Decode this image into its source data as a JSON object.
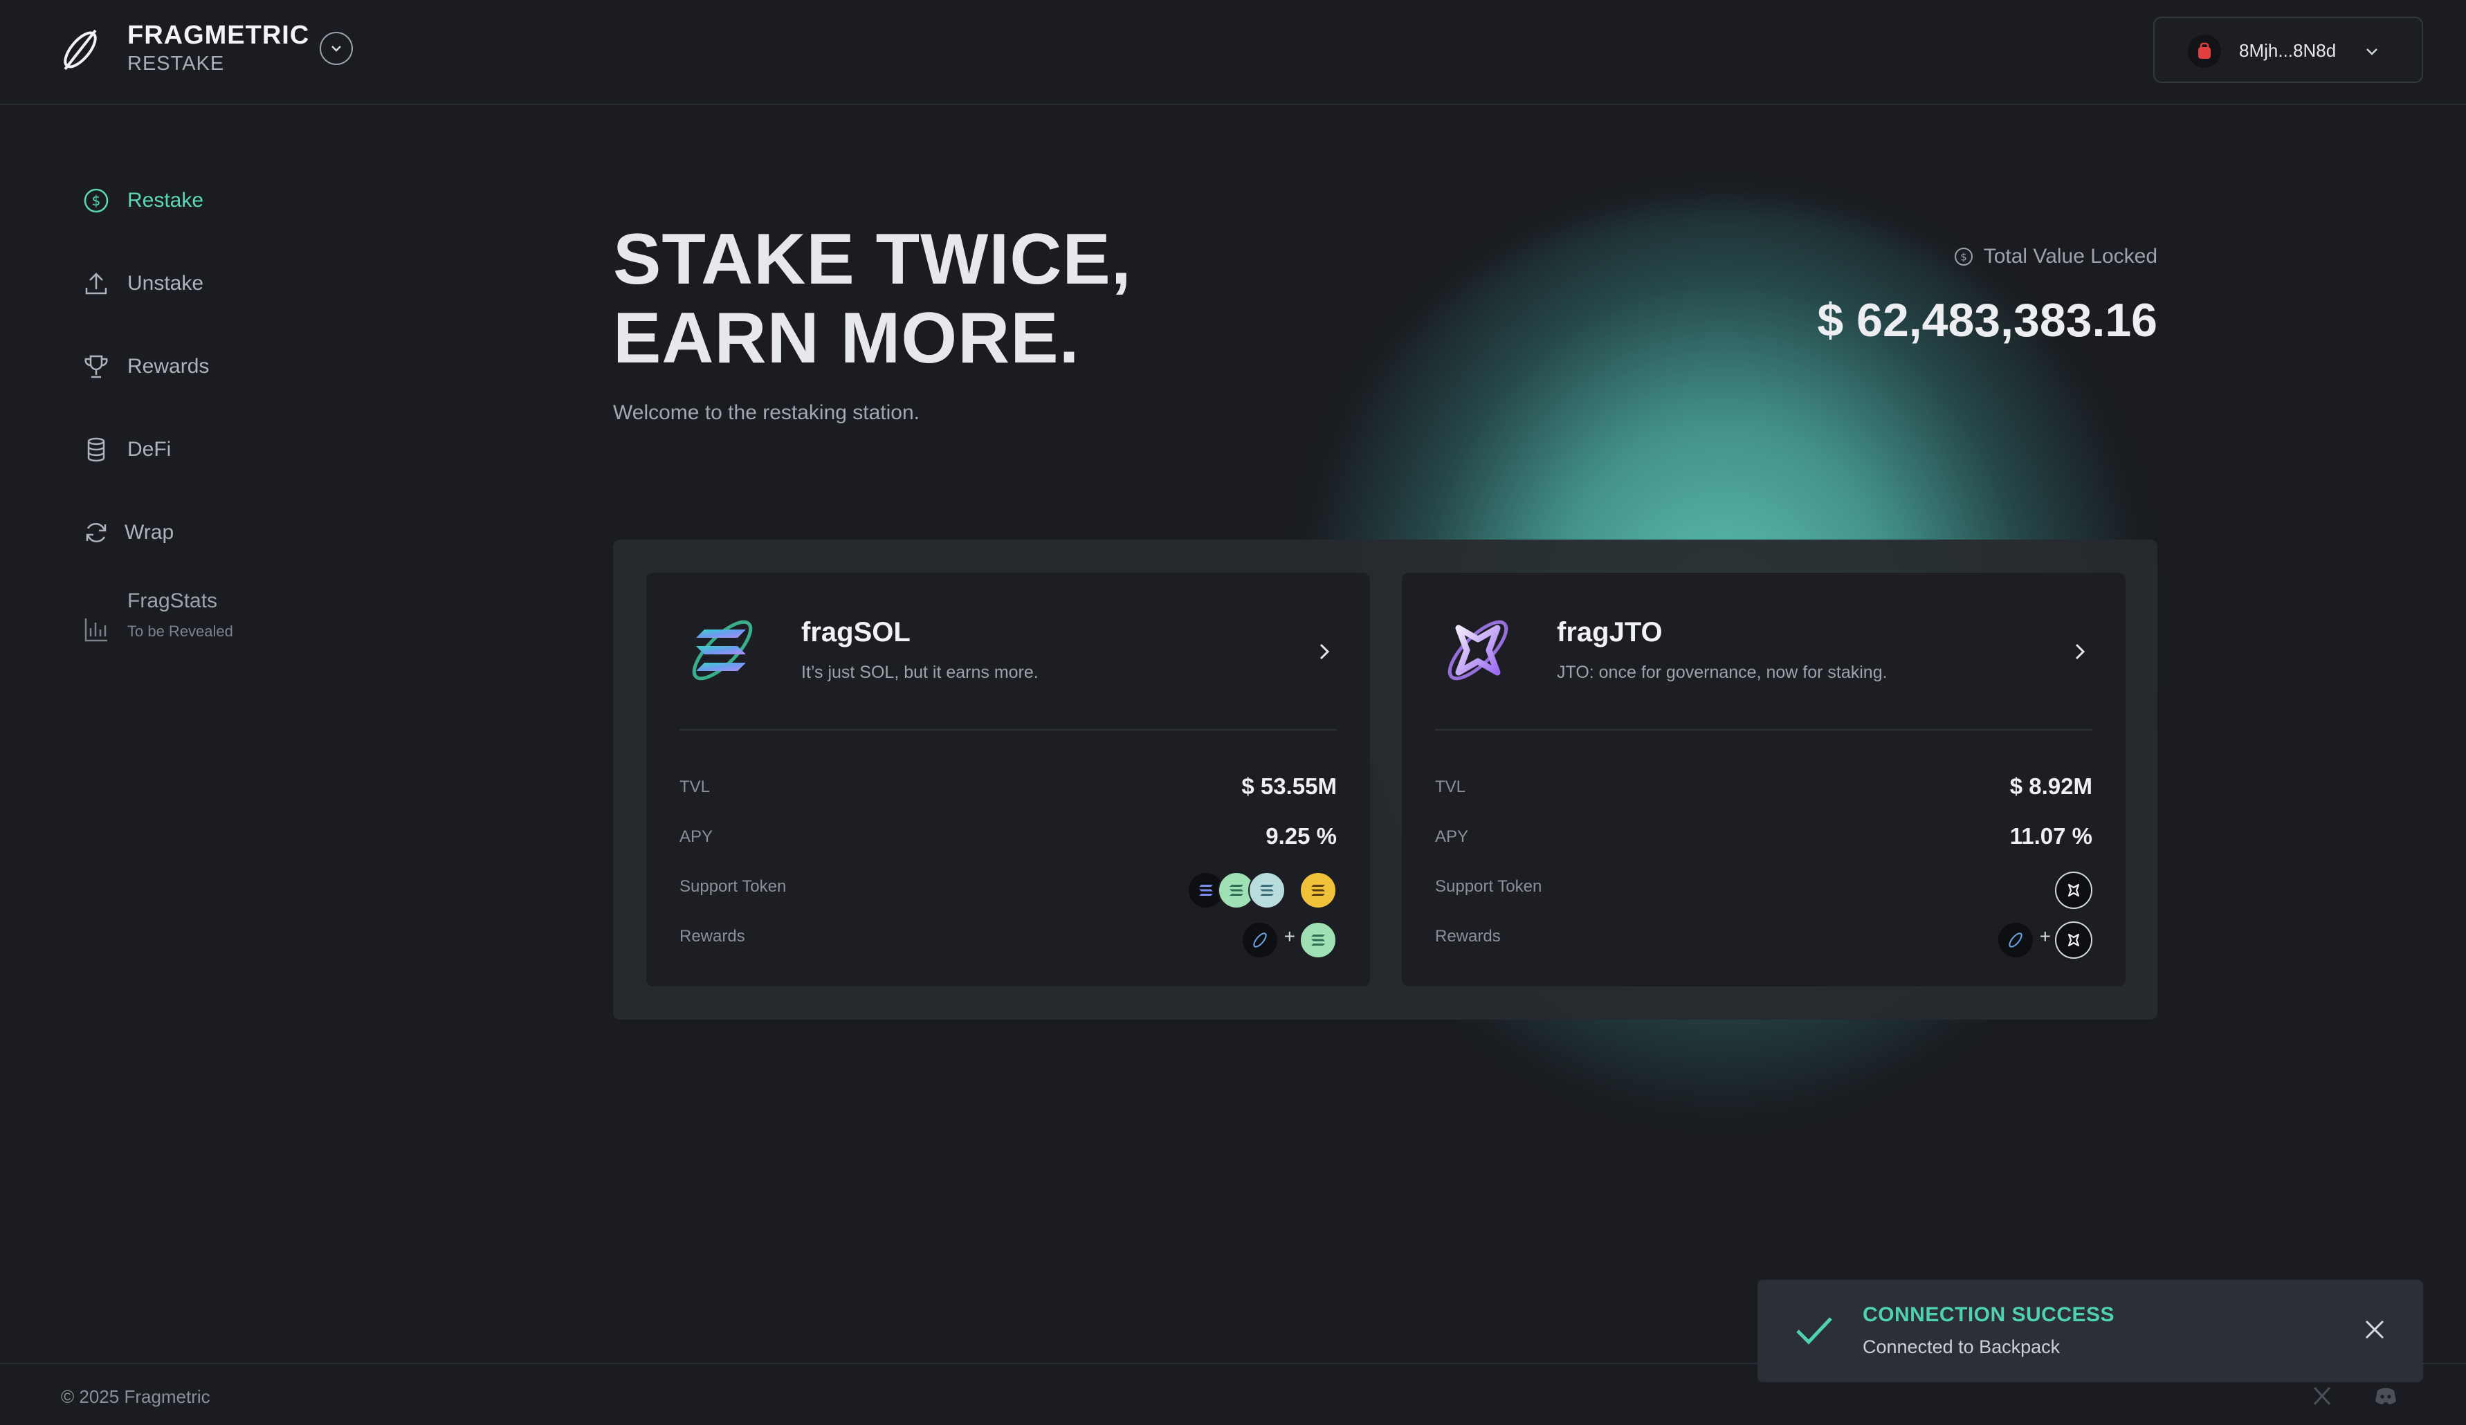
{
  "header": {
    "brand_title": "FRAGMETRIC",
    "brand_sub": "RESTAKE",
    "wallet_address": "8Mjh...8N8d"
  },
  "sidebar": {
    "items": [
      {
        "label": "Restake",
        "icon": "dollar-circle-icon",
        "active": true
      },
      {
        "label": "Unstake",
        "icon": "upload-icon",
        "active": false
      },
      {
        "label": "Rewards",
        "icon": "trophy-icon",
        "active": false
      },
      {
        "label": "DeFi",
        "icon": "database-icon",
        "active": false
      },
      {
        "label": "Wrap",
        "icon": "refresh-icon",
        "active": false
      },
      {
        "label": "FragStats",
        "icon": "bar-chart-icon",
        "active": false,
        "sub": "To be Revealed"
      }
    ]
  },
  "hero": {
    "title_line1": "STAKE TWICE,",
    "title_line2": "EARN MORE.",
    "subtitle": "Welcome to the restaking station.",
    "tvl_label": "Total Value Locked",
    "tvl_value": "$ 62,483,383.16"
  },
  "cards": [
    {
      "name": "fragSOL",
      "description": "It’s just SOL, but it earns more.",
      "tvl_label": "TVL",
      "tvl": "$ 53.55M",
      "apy_label": "APY",
      "apy": "9.25 %",
      "support_label": "Support Token",
      "rewards_label": "Rewards"
    },
    {
      "name": "fragJTO",
      "description": "JTO: once for governance, now for staking.",
      "tvl_label": "TVL",
      "tvl": "$ 8.92M",
      "apy_label": "APY",
      "apy": "11.07 %",
      "support_label": "Support Token",
      "rewards_label": "Rewards"
    }
  ],
  "toast": {
    "title": "CONNECTION SUCCESS",
    "message": "Connected to Backpack"
  },
  "footer": {
    "copyright": "© 2025 Fragmetric"
  },
  "colors": {
    "accent": "#5cd6b5",
    "background": "#1a1c21",
    "panel": "#272a2f",
    "card": "#1c1e23"
  }
}
